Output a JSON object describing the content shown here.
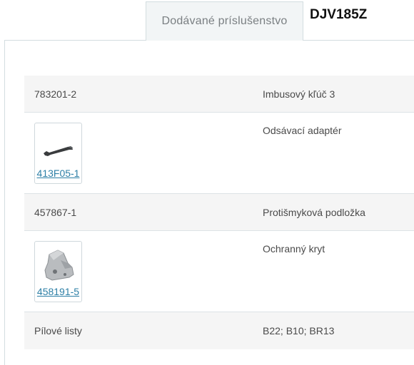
{
  "header": {
    "tab_label": "Dodávané príslušenstvo",
    "model": "DJV185Z"
  },
  "rows": [
    {
      "left": "783201-2",
      "right": "Imbusový kľúč 3"
    },
    {
      "link": "413F05-1",
      "image_icon": "hex-key-icon",
      "right": "Odsávací adaptér"
    },
    {
      "left": "457867-1",
      "right": "Protišmyková podložka"
    },
    {
      "link": "458191-5",
      "image_icon": "cover-plate-icon",
      "right": "Ochranný kryt"
    },
    {
      "left": "Pílové listy",
      "right": "B22; B10; BR13"
    }
  ]
}
